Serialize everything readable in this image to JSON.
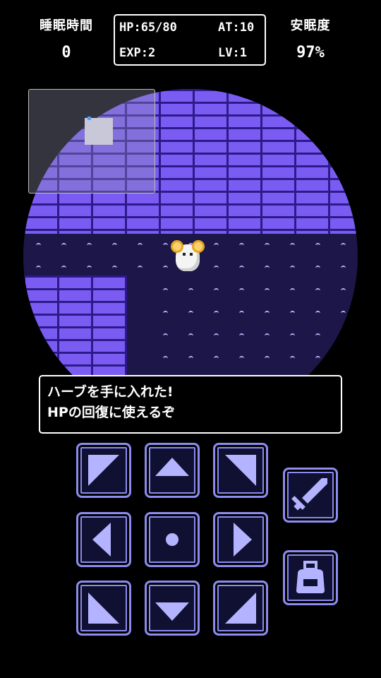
{
  "hud": {
    "sleep_time_label": "睡眠時間",
    "sleep_time_value": "0",
    "rest_label": "安眠度",
    "rest_value": "97%",
    "hp": "HP:65/80",
    "at": "AT:10",
    "exp": "EXP:2",
    "lv": "LV:1"
  },
  "message": {
    "line1": "ハーブを手に入れた!",
    "line2": "HPの回復に使えるぞ"
  },
  "controls": {
    "dpad": [
      "up-left",
      "up",
      "up-right",
      "left",
      "wait",
      "right",
      "down-left",
      "down",
      "down-right"
    ],
    "actions": [
      "sword-icon",
      "bag-icon"
    ]
  },
  "colors": {
    "wall": "#7a5cf2",
    "mortar": "#2d1a8a",
    "floor": "#1d1648",
    "button_border": "#8b8bf0",
    "button_fill": "#101032",
    "icon": "#b3b3ff"
  }
}
